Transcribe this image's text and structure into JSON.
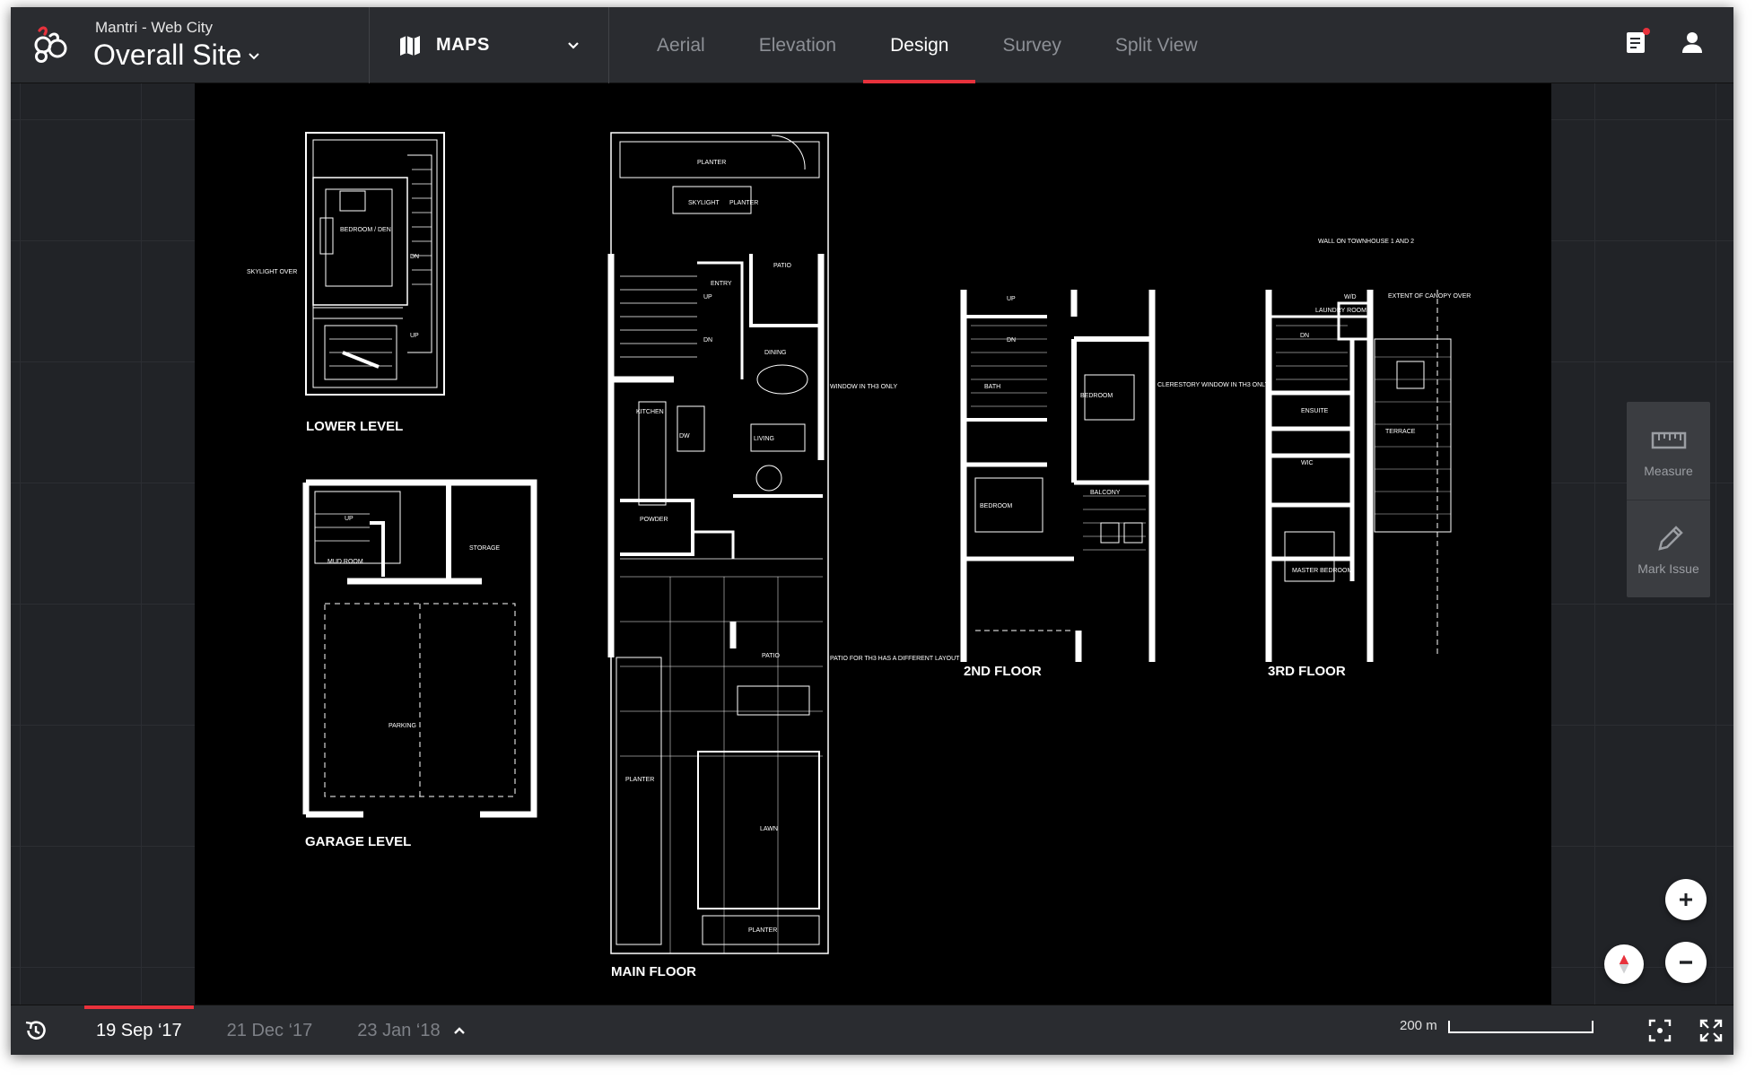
{
  "app": {
    "project": "Mantri - Web City",
    "site": "Overall Site"
  },
  "map_selector": {
    "label": "MAPS"
  },
  "tabs": [
    {
      "label": "Aerial",
      "active": false
    },
    {
      "label": "Elevation",
      "active": false
    },
    {
      "label": "Design",
      "active": true
    },
    {
      "label": "Survey",
      "active": false
    },
    {
      "label": "Split View",
      "active": false
    }
  ],
  "colors": {
    "accent": "#e8323c",
    "bar": "#2a2c30",
    "canvas": "#212327"
  },
  "icons": {
    "logo": "mantri-logo-icon",
    "map": "map-icon",
    "notes": "notes-icon",
    "user": "user-icon",
    "history": "history-icon",
    "focus": "focus-icon",
    "fullscreen": "fullscreen-icon"
  },
  "floorplan": {
    "levels": {
      "lower": "LOWER LEVEL",
      "garage": "GARAGE LEVEL",
      "main": "MAIN FLOOR",
      "second": "2ND FLOOR",
      "third": "3RD FLOOR"
    },
    "rooms": {
      "bedroom_den": "BEDROOM / DEN",
      "skylight_over": "SKYLIGHT OVER",
      "dn": "DN",
      "up": "UP",
      "mud_room": "MUD ROOM",
      "storage": "STORAGE",
      "parking": "PARKING",
      "planter": "PLANTER",
      "skylight": "SKYLIGHT",
      "patio": "PATIO",
      "entry": "ENTRY",
      "dining": "DINING",
      "kitchen": "KITCHEN",
      "dw": "DW",
      "living": "LIVING",
      "powder": "POWDER",
      "lawn": "LAWN",
      "bath": "BATH",
      "bedroom": "BEDROOM",
      "balcony": "BALCONY",
      "wd": "W/D",
      "laundry_room": "LAUNDRY ROOM",
      "ensuite": "ENSUITE",
      "wic": "WIC",
      "terrace": "TERRACE",
      "master_bedroom": "MASTER BEDROOM"
    },
    "notes": {
      "window_th3": "WINDOW IN TH3 ONLY",
      "patio_th3": "PATIO FOR TH3 HAS A DIFFERENT LAYOUT",
      "clerestory": "CLERESTORY WINDOW IN TH3 ONLY",
      "wall_townhouse": "WALL ON TOWNHOUSE 1 AND 2",
      "canopy": "EXTENT OF CANOPY OVER"
    }
  },
  "tools": [
    {
      "label": "Measure",
      "icon": "ruler-icon"
    },
    {
      "label": "Mark Issue",
      "icon": "pencil-icon"
    }
  ],
  "timeline": {
    "dates": [
      {
        "label": "19 Sep ‘17",
        "active": true
      },
      {
        "label": "21 Dec ‘17",
        "active": false
      },
      {
        "label": "23 Jan ‘18",
        "active": false
      }
    ]
  },
  "scale": {
    "label": "200 m"
  }
}
